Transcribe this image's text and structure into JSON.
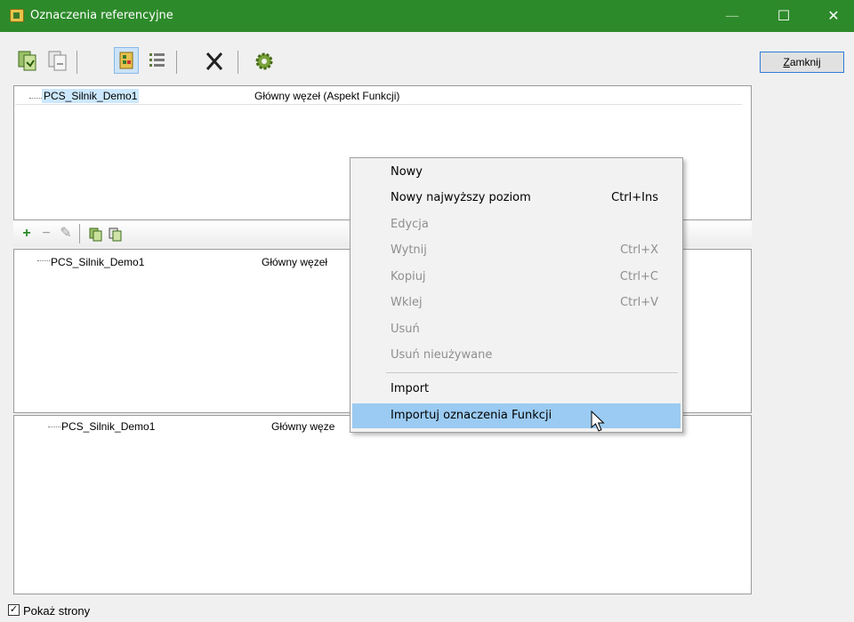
{
  "window": {
    "title": "Oznaczenia referencyjne",
    "controls": {
      "minimize": "—",
      "maximize": "☐",
      "close": "✕"
    }
  },
  "toolbar": {
    "buttons": [
      "copy-green-icon",
      "copy-gray-icon",
      "tree-view-icon",
      "list-view-icon",
      "delete-icon",
      "settings-gear-icon"
    ]
  },
  "close_button_label": "Zamknij",
  "panels": [
    {
      "node": "PCS_Silnik_Demo1",
      "description": "Główny węzeł  (Aspekt Funkcji)"
    },
    {
      "node": "PCS_Silnik_Demo1",
      "description": "Główny węzeł"
    },
    {
      "node": "PCS_Silnik_Demo1",
      "description": "Główny węze"
    }
  ],
  "subtoolbar": {
    "add": "+",
    "remove": "−",
    "edit": "✎"
  },
  "context_menu": {
    "items": [
      {
        "label": "Nowy",
        "shortcut": "",
        "disabled": false
      },
      {
        "label": "Nowy najwyższy poziom",
        "shortcut": "Ctrl+Ins",
        "disabled": false
      },
      {
        "label": "Edycja",
        "shortcut": "",
        "disabled": true
      },
      {
        "label": "Wytnij",
        "shortcut": "Ctrl+X",
        "disabled": true
      },
      {
        "label": "Kopiuj",
        "shortcut": "Ctrl+C",
        "disabled": true
      },
      {
        "label": "Wklej",
        "shortcut": "Ctrl+V",
        "disabled": true
      },
      {
        "label": "Usuń",
        "shortcut": "",
        "disabled": true
      },
      {
        "label": "Usuń nieużywane",
        "shortcut": "",
        "disabled": true
      },
      {
        "label": "Import",
        "shortcut": "",
        "disabled": false
      },
      {
        "label": "Importuj oznaczenia Funkcji",
        "shortcut": "",
        "disabled": false,
        "highlighted": true
      }
    ]
  },
  "footer": {
    "show_pages_label": "Pokaż strony",
    "show_pages_checked": true
  },
  "colors": {
    "titlebar": "#2d8a2a",
    "selection": "#9bcbf2"
  }
}
